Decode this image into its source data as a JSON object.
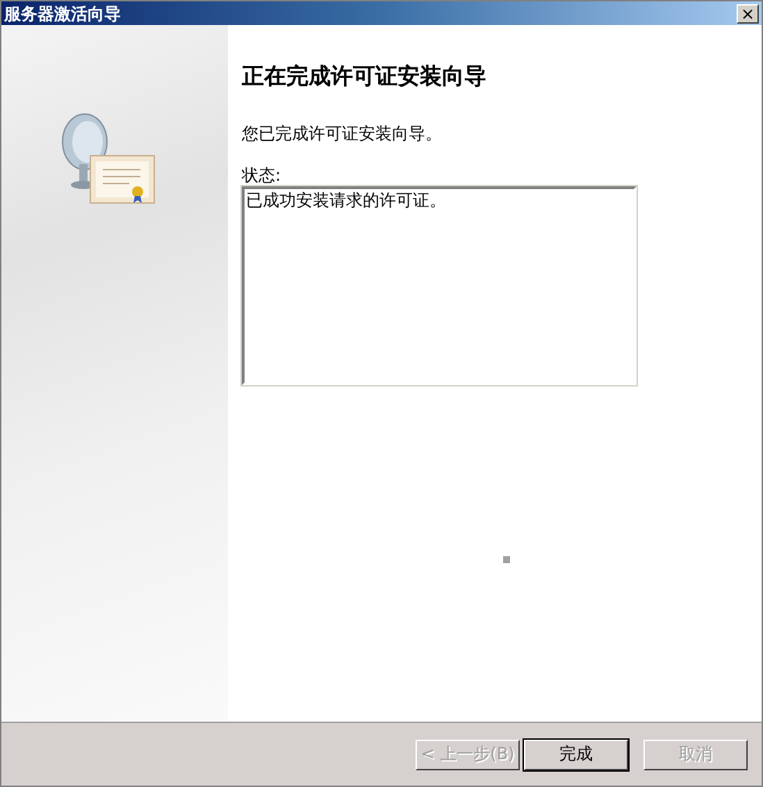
{
  "window": {
    "title": "服务器激活向导",
    "close": "×"
  },
  "heading": "正在完成许可证安装向导",
  "message": "您已完成许可证安装向导。",
  "status": {
    "label": "状态:",
    "value": "已成功安装请求的许可证。"
  },
  "buttons": [
    {
      "label": "< 上一步(B)",
      "disabled": true,
      "default": false
    },
    {
      "label": "完成",
      "disabled": false,
      "default": true
    },
    {
      "label": "取消",
      "disabled": true,
      "default": false
    }
  ]
}
